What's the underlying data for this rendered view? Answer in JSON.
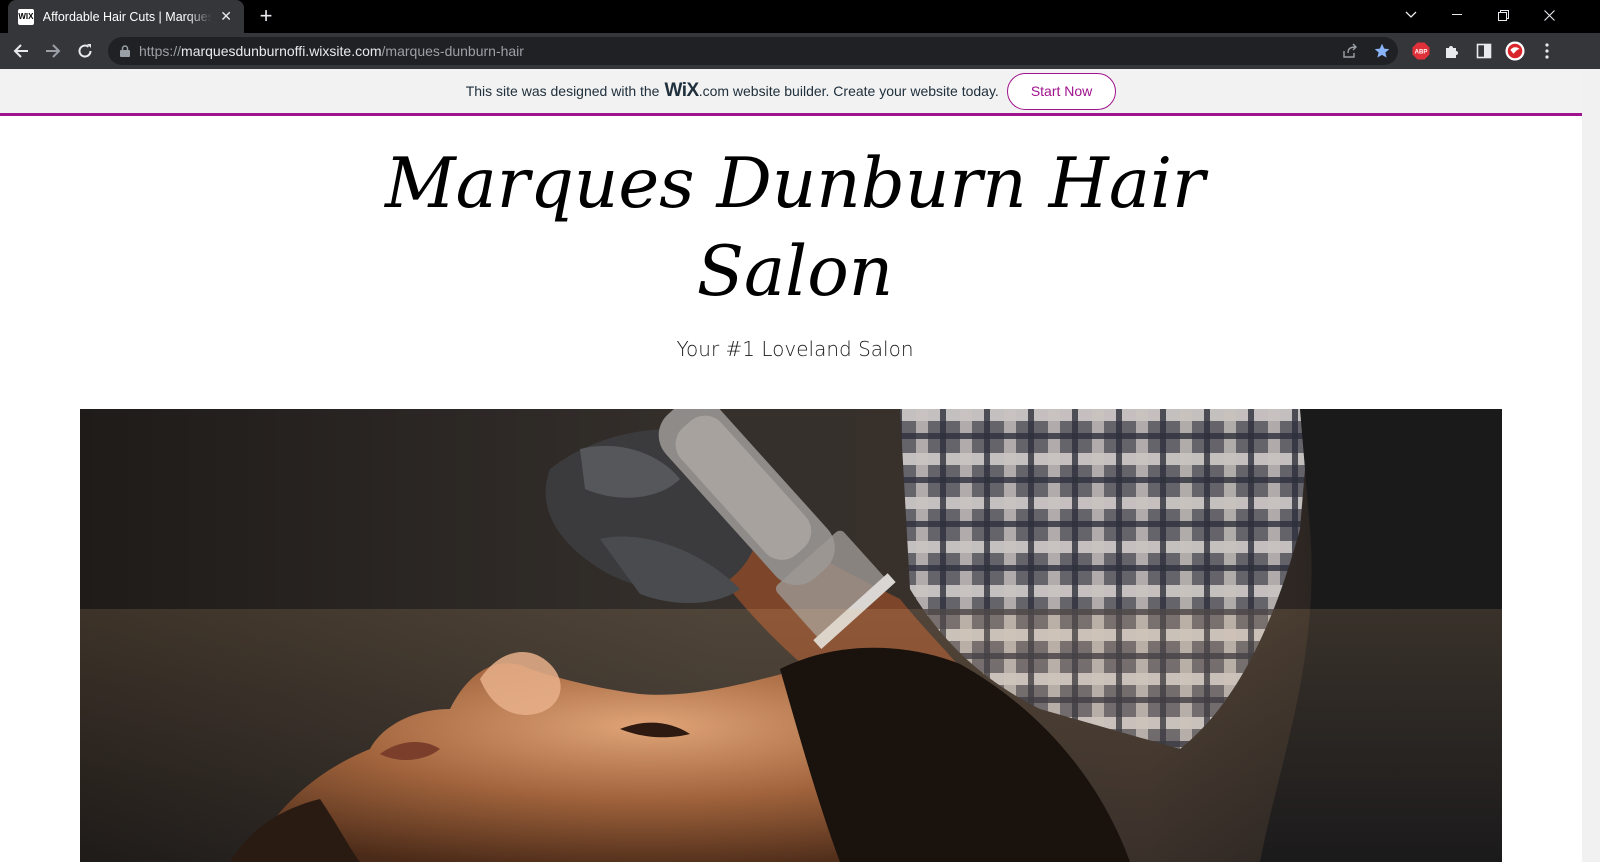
{
  "browser": {
    "tab_title": "Affordable Hair Cuts | Marques Dunburn Hair Salon",
    "favicon_text": "WIX",
    "url_scheme": "https://",
    "url_host": "marquesdunburnoffi.wixsite.com",
    "url_path": "/marques-dunburn-hair"
  },
  "wix_banner": {
    "prefix": "This site was designed with the",
    "logo": "WiX",
    "suffix": ".com website builder. Create your website today.",
    "button_label": "Start Now",
    "accent_color": "#a0138e"
  },
  "site": {
    "title_line1": "Marques Dunburn Hair",
    "title_line2": "Salon",
    "tagline": "Your #1 Loveland Salon"
  },
  "extensions": {
    "abp_label": "ABP"
  }
}
